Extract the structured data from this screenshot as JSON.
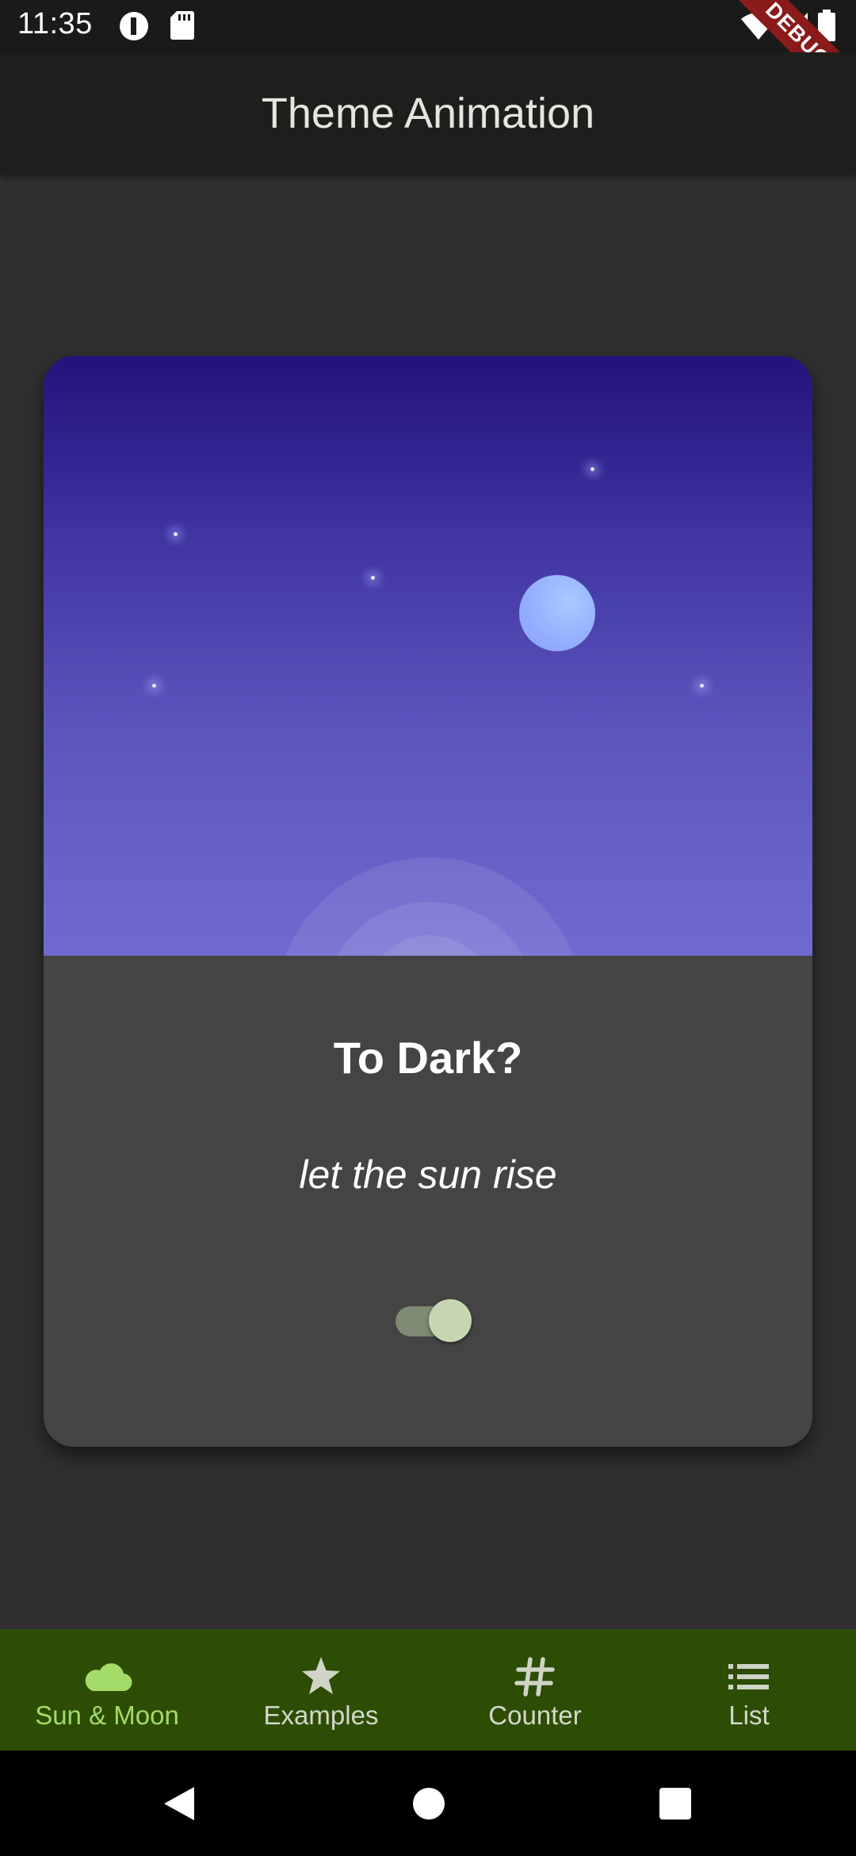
{
  "status_bar": {
    "time": "11:35",
    "icons": [
      "alert-circle-icon",
      "sd-card-icon",
      "wifi-icon",
      "signal-icon",
      "battery-icon"
    ],
    "debug_banner": "DEBUG"
  },
  "app_bar": {
    "title": "Theme Animation"
  },
  "card": {
    "title": "To Dark?",
    "subtitle": "let the sun rise",
    "toggle": {
      "checked": true
    },
    "sky_colors": {
      "top": "#23127b",
      "bottom": "#6f6ad0"
    },
    "moon_color": "#94aeff"
  },
  "bottom_nav": {
    "items": [
      {
        "label": "Sun & Moon",
        "icon": "cloud-icon",
        "active": true
      },
      {
        "label": "Examples",
        "icon": "star-icon",
        "active": false
      },
      {
        "label": "Counter",
        "icon": "hash-icon",
        "active": false
      },
      {
        "label": "List",
        "icon": "list-icon",
        "active": false
      }
    ],
    "background": "#2d4d05",
    "active_color": "#a3db68",
    "inactive_color": "#d3d8c9"
  },
  "system_nav": {
    "buttons": [
      "back-icon",
      "home-icon",
      "recents-icon"
    ]
  }
}
